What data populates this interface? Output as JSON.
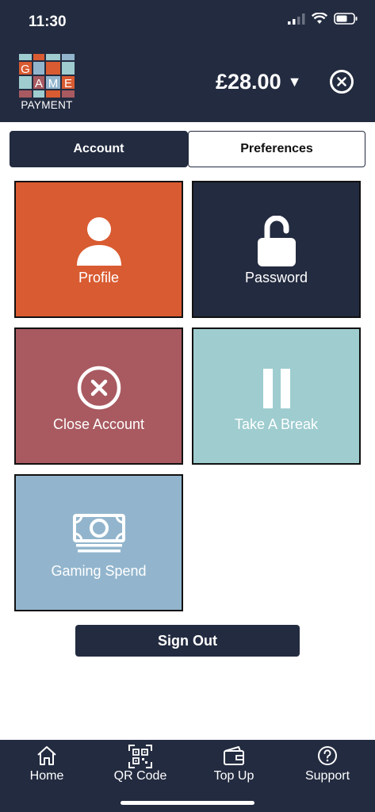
{
  "status_bar": {
    "time": "11:30"
  },
  "header": {
    "logo_word": "PAYMENT",
    "logo_letters": [
      "G",
      "A",
      "M",
      "E"
    ],
    "balance": "£28.00",
    "balance_caret": "▼"
  },
  "tabs": [
    {
      "label": "Account",
      "active": true
    },
    {
      "label": "Preferences",
      "active": false
    }
  ],
  "tiles": [
    {
      "label": "Profile",
      "icon": "user-icon",
      "color": "#d95b31"
    },
    {
      "label": "Password",
      "icon": "padlock-open-icon",
      "color": "#232b40"
    },
    {
      "label": "Close Account",
      "icon": "close-circle-icon",
      "color": "#a85a60"
    },
    {
      "label": "Take A Break",
      "icon": "pause-icon",
      "color": "#9ecccf"
    },
    {
      "label": "Gaming Spend",
      "icon": "money-icon",
      "color": "#92b5cd"
    }
  ],
  "sign_out": {
    "label": "Sign Out"
  },
  "bottom_nav": [
    {
      "label": "Home",
      "icon": "home-icon"
    },
    {
      "label": "QR Code",
      "icon": "qr-code-icon"
    },
    {
      "label": "Top Up",
      "icon": "wallet-icon"
    },
    {
      "label": "Support",
      "icon": "help-icon"
    }
  ],
  "colors": {
    "navy": "#232b40",
    "orange": "#d95b31",
    "rose": "#a85a60",
    "teal": "#9ecccf",
    "blue": "#92b5cd"
  }
}
